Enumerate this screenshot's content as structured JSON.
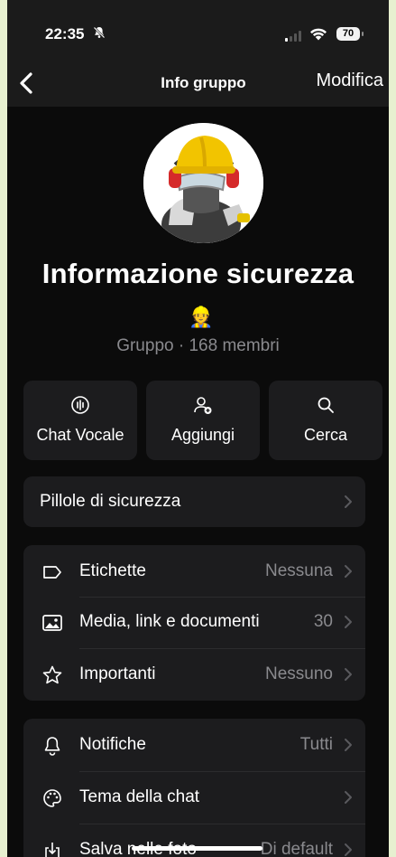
{
  "status_bar": {
    "time": "22:35",
    "battery": "70"
  },
  "nav": {
    "title": "Info gruppo",
    "edit": "Modifica"
  },
  "group": {
    "name": "Informazione sicurezza",
    "emoji": "👷",
    "subtitle": "Gruppo · 168 membri"
  },
  "actions": [
    {
      "label": "Chat Vocale",
      "icon": "voice-chat-icon"
    },
    {
      "label": "Aggiungi",
      "icon": "add-person-icon"
    },
    {
      "label": "Cerca",
      "icon": "search-icon"
    }
  ],
  "description": {
    "label": "Pillole di sicurezza"
  },
  "section1": [
    {
      "label": "Etichette",
      "value": "Nessuna",
      "icon": "label-tag-icon"
    },
    {
      "label": "Media, link e documenti",
      "value": "30",
      "icon": "photo-icon"
    },
    {
      "label": "Importanti",
      "value": "Nessuno",
      "icon": "star-icon"
    }
  ],
  "section2": [
    {
      "label": "Notifiche",
      "value": "Tutti",
      "icon": "bell-icon"
    },
    {
      "label": "Tema della chat",
      "value": "",
      "icon": "palette-icon"
    },
    {
      "label": "Salva nelle foto",
      "value": "Di default",
      "icon": "download-icon"
    }
  ],
  "colors": {
    "background": "#0b0b0b",
    "card": "#1c1c1e",
    "secondary_text": "#8a8a8e"
  }
}
